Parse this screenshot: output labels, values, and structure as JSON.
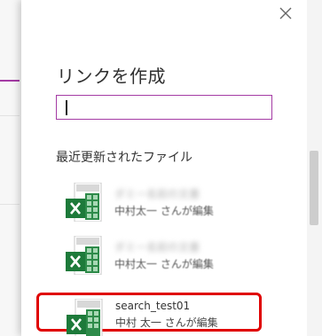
{
  "panel": {
    "title": "リンクを作成",
    "link_input": {
      "value": "",
      "placeholder": ""
    },
    "section_header": "最近更新されたファイル",
    "close_icon": "close-icon"
  },
  "files": [
    {
      "name": "ダミー名前の文書",
      "meta": "中村太一 さんが編集",
      "icon": "excel-file-icon"
    },
    {
      "name": "ダミー名前の文書",
      "meta": "中村太一 さんが編集",
      "icon": "excel-file-icon"
    },
    {
      "name": "search_test01",
      "meta": "中村 太一 さんが編集",
      "icon": "excel-file-icon",
      "selected": true
    }
  ],
  "colors": {
    "accent": "#a43ba4",
    "highlight": "#e00000",
    "excel_green": "#1d7a3a"
  }
}
